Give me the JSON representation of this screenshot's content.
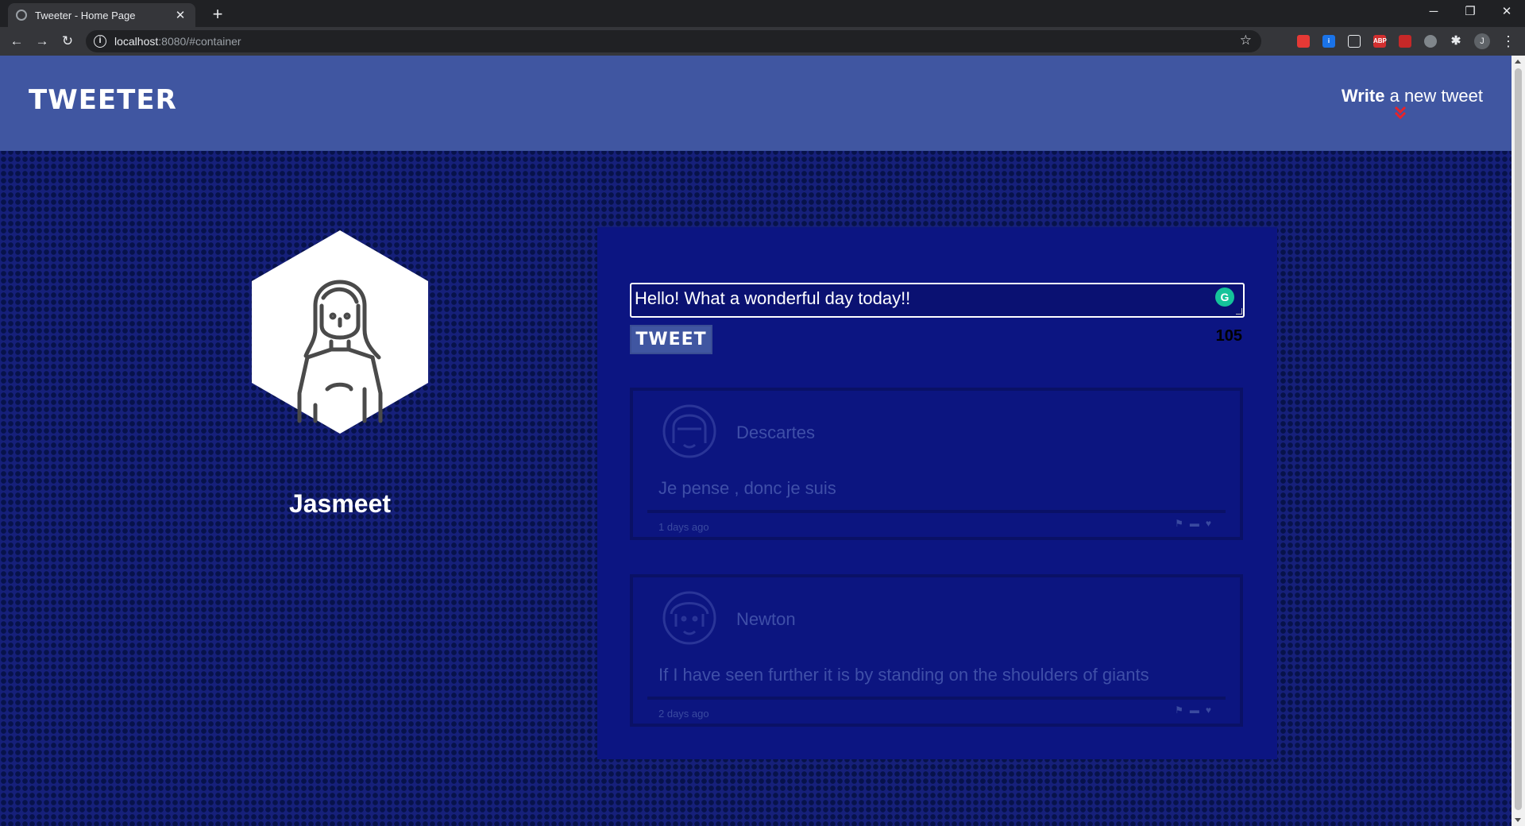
{
  "browser": {
    "tab_title": "Tweeter - Home Page",
    "url_host": "localhost",
    "url_path": ":8080/#container",
    "icons": [
      "back-icon",
      "forward-icon",
      "reload-icon",
      "site-info-icon",
      "bookmark-star-icon",
      "extensions-icon",
      "menu-icon"
    ],
    "profile_initial": "J",
    "extensions": [
      {
        "name": "ext-red",
        "color": "#e53935",
        "label": ""
      },
      {
        "name": "ext-blue-info",
        "color": "#1a73e8",
        "label": "i"
      },
      {
        "name": "ext-outline",
        "color": "#5f6368",
        "label": ""
      },
      {
        "name": "ext-abp",
        "color": "#d32f2f",
        "label": "ABP"
      },
      {
        "name": "ext-acrobat",
        "color": "#c62828",
        "label": ""
      },
      {
        "name": "ext-gray",
        "color": "#80868b",
        "label": ""
      }
    ]
  },
  "header": {
    "logo": "TWEETER",
    "write_bold": "Write",
    "write_rest": " a new tweet",
    "chevron_color": "#e8232a"
  },
  "profile": {
    "username": "Jasmeet"
  },
  "composer": {
    "text": "Hello! What a wonderful day today!!",
    "button_label": "TWEET",
    "counter": "105"
  },
  "tweets": [
    {
      "name": "Descartes",
      "text": "Je pense , donc je suis",
      "time": "1 days ago"
    },
    {
      "name": "Newton",
      "text": "If I have seen further it is by standing on the shoulders of giants",
      "time": "2 days ago"
    }
  ],
  "colors": {
    "header_bg": "#4056a1",
    "page_bg": "#16207a",
    "panel_bg": "#0c1582"
  }
}
